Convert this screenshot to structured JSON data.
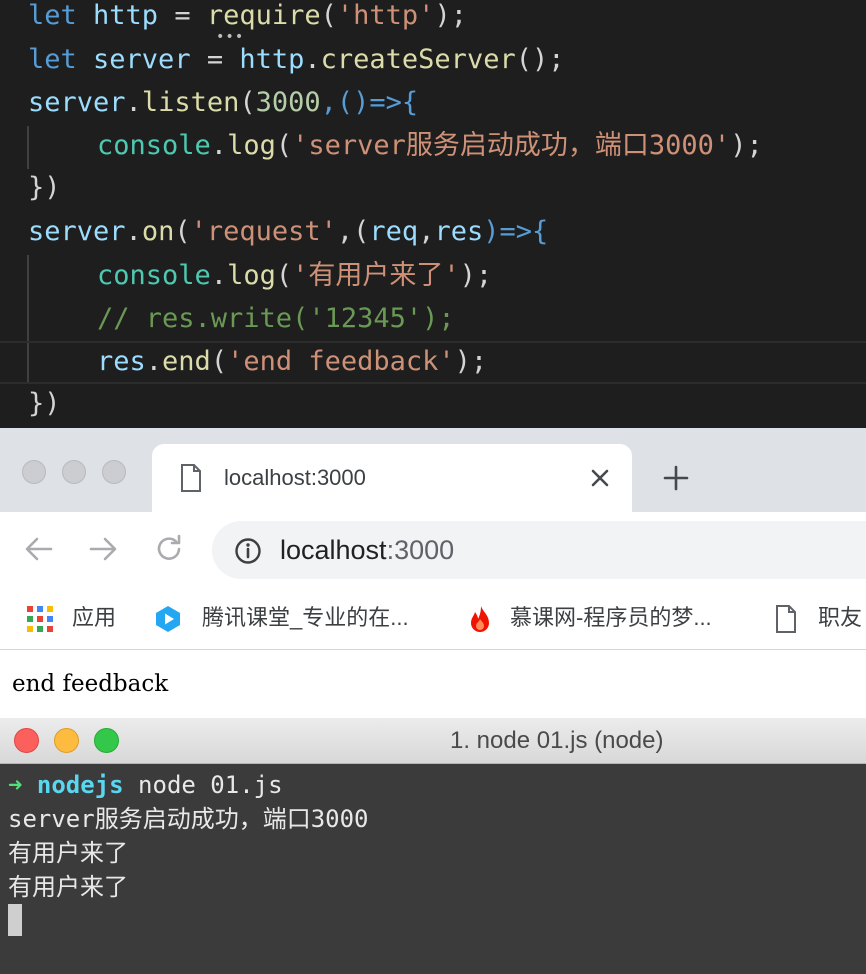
{
  "editor": {
    "lines": [
      {
        "parts": [
          "let",
          " http ",
          "=",
          " require",
          "(",
          "'http'",
          ");"
        ]
      },
      {
        "parts": [
          "let",
          " server ",
          "=",
          " http",
          ".",
          "createServer",
          "();"
        ]
      },
      {
        "parts": [
          "server",
          ".",
          "listen",
          "(",
          "3000",
          ",()=>{"
        ]
      },
      {
        "parts": [
          "console",
          ".",
          "log",
          "(",
          "'server服务启动成功，端口3000'",
          ");"
        ]
      },
      {
        "parts": [
          "})"
        ]
      },
      {
        "parts": [
          "server",
          ".",
          "on",
          "(",
          "'request'",
          ",(",
          "req",
          ",",
          "res",
          ")=>{"
        ]
      },
      {
        "parts": [
          "console",
          ".",
          "log",
          "(",
          "'有用户来了'",
          ");"
        ]
      },
      {
        "parts": [
          "// res.write('12345');"
        ]
      },
      {
        "parts": [
          "res",
          ".",
          "end",
          "(",
          "'end feedback'",
          ");"
        ]
      },
      {
        "parts": [
          "})"
        ]
      }
    ]
  },
  "browser": {
    "tab_title": "localhost:3000",
    "url_host": "localhost",
    "url_port": ":3000",
    "bookmarks": [
      {
        "label": "应用",
        "icon": "apps-grid-icon"
      },
      {
        "label": "腾讯课堂_专业的在...",
        "icon": "tencent-classroom-icon"
      },
      {
        "label": "慕课网-程序员的梦...",
        "icon": "imooc-flame-icon"
      },
      {
        "label": "职友",
        "icon": "page-icon"
      }
    ],
    "page_text": "end feedback"
  },
  "terminal": {
    "title": "1. node 01.js (node)",
    "prompt_arrow": "➜",
    "prompt_dir": "nodejs",
    "command": " node 01.js",
    "output": [
      "server服务启动成功，端口3000",
      "有用户来了",
      "有用户来了"
    ]
  },
  "colors": {
    "editor_bg": "#1e1e1e",
    "keyword": "#569cd6",
    "string": "#ce9178",
    "function": "#dcdcaa",
    "class": "#4ec9b0",
    "comment": "#6a9955",
    "terminal_bg": "#3b3b3b",
    "prompt_green": "#50e07a",
    "prompt_cyan": "#5ad7f0"
  }
}
